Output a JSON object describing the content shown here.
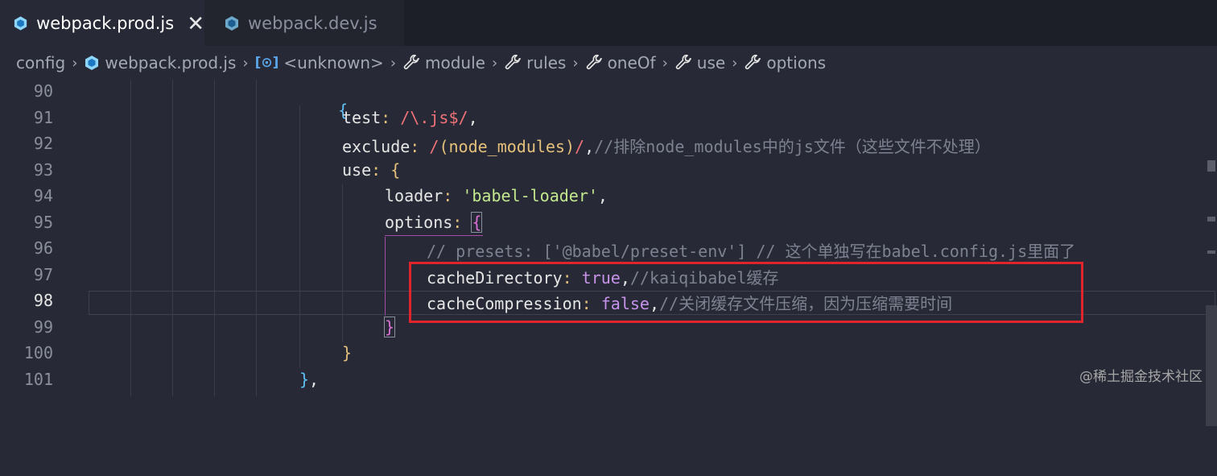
{
  "tabs": [
    {
      "label": "webpack.prod.js",
      "active": true,
      "icon": "webpack-icon"
    },
    {
      "label": "webpack.dev.js",
      "active": false,
      "icon": "webpack-icon"
    }
  ],
  "tab_close_glyph": "✕",
  "breadcrumb": {
    "items": [
      {
        "label": "config",
        "icon": ""
      },
      {
        "label": "webpack.prod.js",
        "icon": "webpack-icon"
      },
      {
        "label": "<unknown>",
        "icon": "variable-icon",
        "icon_text": "[⊙]"
      },
      {
        "label": "module",
        "icon": "wrench-icon"
      },
      {
        "label": "rules",
        "icon": "wrench-icon"
      },
      {
        "label": "oneOf",
        "icon": "wrench-icon"
      },
      {
        "label": "use",
        "icon": "wrench-icon"
      },
      {
        "label": "options",
        "icon": "wrench-icon"
      }
    ],
    "separator": "›"
  },
  "line_numbers": [
    "90",
    "91",
    "92",
    "93",
    "94",
    "95",
    "96",
    "97",
    "98",
    "99",
    "100",
    "101"
  ],
  "current_line": "98",
  "code": {
    "l90_brace": "{",
    "l91_key": "test",
    "l91_colon": ":",
    "l91_regex": "/\\.js$/",
    "l91_comma": ",",
    "l92_key": "exclude",
    "l92_colon": ":",
    "l92_regex_open": "/",
    "l92_paren_open": "(",
    "l92_inner": "node_modules",
    "l92_paren_close": ")",
    "l92_regex_close": "/",
    "l92_comma": ",",
    "l92_comment": "//排除node_modules中的js文件（这些文件不处理）",
    "l93_key": "use",
    "l93_colon": ":",
    "l93_brace": "{",
    "l94_key": "loader",
    "l94_colon": ":",
    "l94_str": "'babel-loader'",
    "l94_comma": ",",
    "l95_key": "options",
    "l95_colon": ":",
    "l95_brace": "{",
    "l96_comment": "// presets: ['@babel/preset-env'] // 这个单独写在babel.config.js里面了",
    "l97_key": "cacheDirectory",
    "l97_colon": ":",
    "l97_bool": "true",
    "l97_comma": ",",
    "l97_comment": "//kaiqibabel缓存",
    "l98_key": "cacheCompression",
    "l98_colon": ":",
    "l98_bool": "false",
    "l98_comma": ",",
    "l98_comment": "//关闭缓存文件压缩，因为压缩需要时间",
    "l99_brace": "}",
    "l100_brace": "}",
    "l101_brace": "}",
    "l101_comma": ","
  },
  "watermark": "@稀土掘金技术社区",
  "colors": {
    "background": "#272a36",
    "tabbar": "#1d1f28",
    "highlight_box": "#e0242b",
    "regex": "#f07178",
    "string": "#c3e88d",
    "boolean": "#c792ea",
    "comment": "#7d8291"
  }
}
